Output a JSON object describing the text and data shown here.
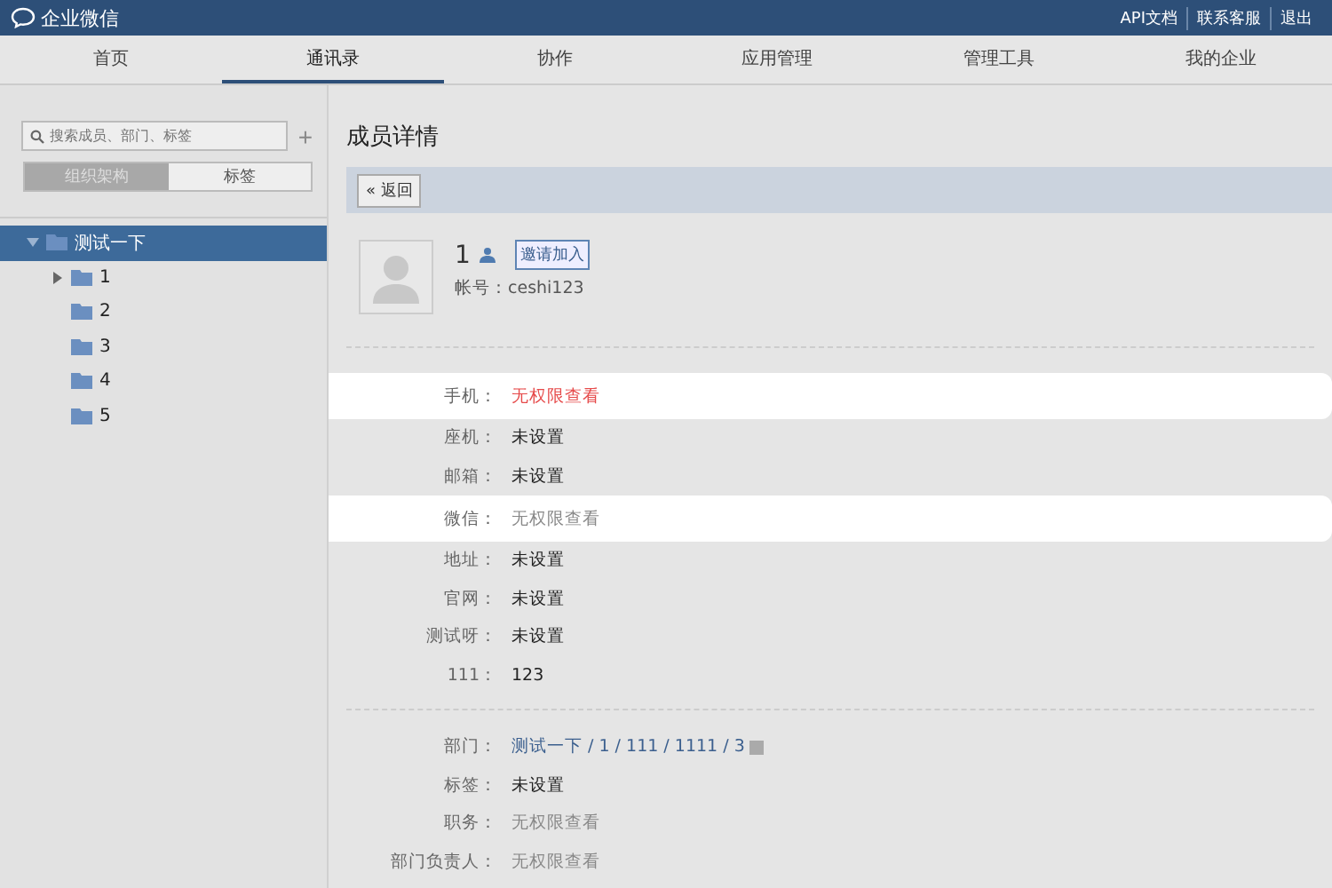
{
  "header": {
    "logo": "企业微信",
    "links": [
      "API文档",
      "联系客服",
      "退出"
    ]
  },
  "tabs": [
    {
      "label": "首页",
      "selected": false
    },
    {
      "label": "通讯录",
      "selected": true
    },
    {
      "label": "协作",
      "selected": false
    },
    {
      "label": "应用管理",
      "selected": false
    },
    {
      "label": "管理工具",
      "selected": false
    },
    {
      "label": "我的企业",
      "selected": false
    }
  ],
  "sidebar": {
    "search": {
      "placeholder": "搜索成员、部门、标签"
    },
    "add": "+",
    "switch": [
      {
        "label": "组织架构",
        "selected": true
      },
      {
        "label": "标签",
        "selected": false
      }
    ],
    "tree": [
      {
        "label": "测试一下",
        "selected": true,
        "expanded": true,
        "children": [
          {
            "label": "1",
            "selected": false,
            "expanded": false
          },
          {
            "label": "2",
            "selected": false
          },
          {
            "label": "3",
            "selected": false
          },
          {
            "label": "4",
            "selected": false
          },
          {
            "label": "5",
            "selected": false
          }
        ]
      }
    ]
  },
  "main": {
    "title": "成员详情",
    "back": "« 返回",
    "member": {
      "name": "1",
      "invite": "邀请加入",
      "account": "帐号：ceshi123"
    },
    "fields": [
      {
        "label": "手机：",
        "value": "无权限查看",
        "kind": "alert",
        "highlighted": true
      },
      {
        "label": "座机：",
        "value": "未设置",
        "kind": "plain",
        "highlighted": false
      },
      {
        "label": "邮箱：",
        "value": "未设置",
        "kind": "plain",
        "highlighted": false
      },
      {
        "label": "微信：",
        "value": "无权限查看",
        "kind": "muted",
        "highlighted": true
      },
      {
        "label": "地址：",
        "value": "未设置",
        "kind": "plain",
        "highlighted": false
      },
      {
        "label": "官网：",
        "value": "未设置",
        "kind": "plain",
        "highlighted": false
      },
      {
        "label": "测试呀：",
        "value": "未设置",
        "kind": "plain",
        "highlighted": false
      },
      {
        "label": "111：",
        "value": "123",
        "kind": "plain",
        "highlighted": false
      }
    ],
    "org_fields": [
      {
        "label": "部门：",
        "value": "测试一下 / 1 / 111 / 1111 / 3",
        "kind": "link",
        "highlighted": false
      },
      {
        "label": "标签：",
        "value": "未设置",
        "kind": "plain",
        "highlighted": false
      },
      {
        "label": "职务：",
        "value": "无权限查看",
        "kind": "muted",
        "highlighted": false
      },
      {
        "label": "部门负责人：",
        "value": "无权限查看",
        "kind": "muted",
        "highlighted": false
      }
    ]
  }
}
